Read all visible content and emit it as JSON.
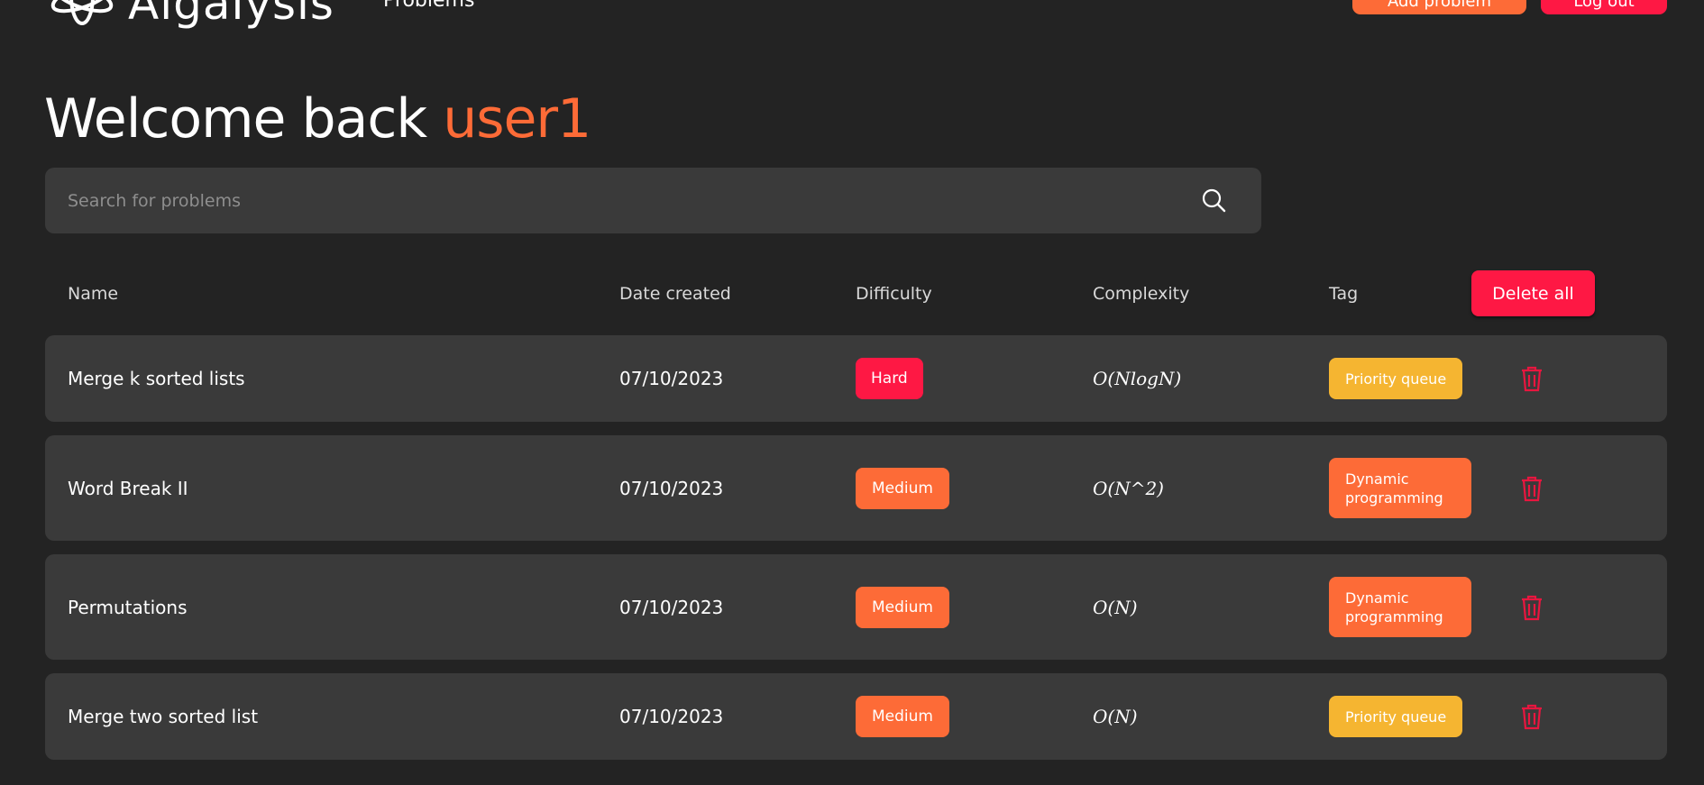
{
  "header": {
    "logo_text": "Algalysis",
    "nav_problems": "Problems",
    "btn_orange_label": "Add problem",
    "btn_red_label": "Log out"
  },
  "welcome": {
    "prefix": "Welcome back ",
    "username": "user1"
  },
  "search": {
    "placeholder": "Search for problems",
    "value": ""
  },
  "table": {
    "headers": {
      "name": "Name",
      "date": "Date created",
      "difficulty": "Difficulty",
      "complexity": "Complexity",
      "tag": "Tag"
    },
    "delete_all_label": "Delete all",
    "rows": [
      {
        "name": "Merge k sorted lists",
        "date": "07/10/2023",
        "difficulty": "Hard",
        "complexity": "O(NlogN)",
        "tag": "Priority queue"
      },
      {
        "name": "Word Break II",
        "date": "07/10/2023",
        "difficulty": "Medium",
        "complexity": "O(N^2)",
        "tag": "Dynamic programming"
      },
      {
        "name": "Permutations",
        "date": "07/10/2023",
        "difficulty": "Medium",
        "complexity": "O(N)",
        "tag": "Dynamic programming"
      },
      {
        "name": "Merge two sorted list",
        "date": "07/10/2023",
        "difficulty": "Medium",
        "complexity": "O(N)",
        "tag": "Priority queue"
      }
    ]
  },
  "colors": {
    "background": "#232323",
    "panel": "#3a3a3a",
    "accent_orange": "#fd6b37",
    "accent_red": "#fe1844",
    "accent_yellow": "#f5b531"
  },
  "icons": {
    "search": "search-icon",
    "delete": "trash-icon",
    "logo": "logo-icon"
  }
}
